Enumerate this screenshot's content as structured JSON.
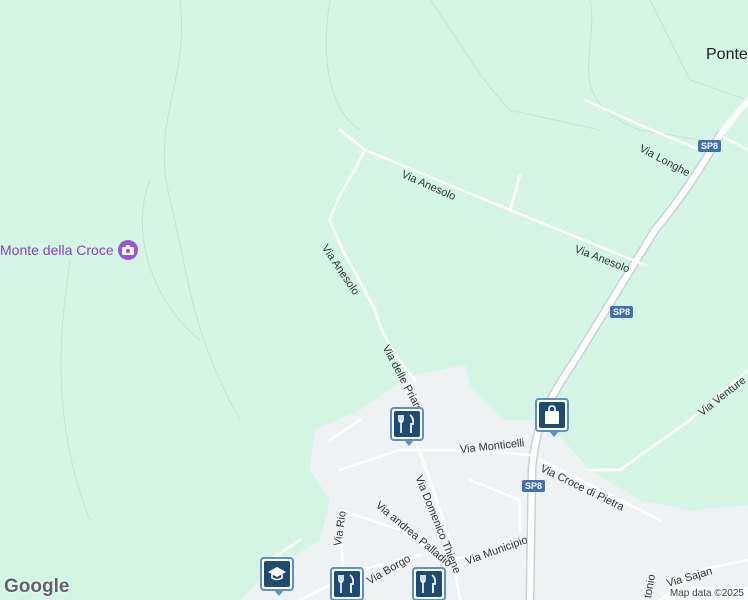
{
  "map": {
    "places": {
      "town": "Ponte",
      "landmark": "Monte della Croce"
    },
    "roads": [
      {
        "id": "anesolo-1",
        "label": "Via Anesolo"
      },
      {
        "id": "anesolo-2",
        "label": "Via Anesolo"
      },
      {
        "id": "anesolo-3",
        "label": "Via Anesolo"
      },
      {
        "id": "longhe",
        "label": "Via Longhe"
      },
      {
        "id": "priare",
        "label": "Via delle Priare"
      },
      {
        "id": "monticelli",
        "label": "Via Monticelli"
      },
      {
        "id": "thiene",
        "label": "Via Domenico Thiene"
      },
      {
        "id": "croce-pietra",
        "label": "Via Croce di Pietra"
      },
      {
        "id": "palladio",
        "label": "Via andrea Palladio"
      },
      {
        "id": "rio",
        "label": "Via Rio"
      },
      {
        "id": "borgo",
        "label": "Via Borgo"
      },
      {
        "id": "municipio",
        "label": "Via Municipio"
      },
      {
        "id": "venture",
        "label": "Via Venture"
      },
      {
        "id": "sajan",
        "label": "Via Sajan"
      },
      {
        "id": "tonio",
        "label": "tonio"
      }
    ],
    "shields": [
      "SP8",
      "SP8",
      "SP8"
    ],
    "pois": [
      {
        "id": "restaurant-1",
        "icon": "restaurant-icon"
      },
      {
        "id": "shopping",
        "icon": "shopping-bag-icon"
      },
      {
        "id": "school",
        "icon": "school-icon"
      },
      {
        "id": "restaurant-2",
        "icon": "restaurant-icon"
      },
      {
        "id": "restaurant-3",
        "icon": "restaurant-icon"
      }
    ],
    "colors": {
      "land": "#d4f5e3",
      "urban": "#eef2f3",
      "road": "#ffffff",
      "road_edge": "#c8d2d6",
      "shield": "#3f6fb5",
      "poi_fill": "#1f4b73",
      "landmark": "#8a3fd1"
    },
    "logo": "Google",
    "attribution": "Map data ©2025"
  }
}
